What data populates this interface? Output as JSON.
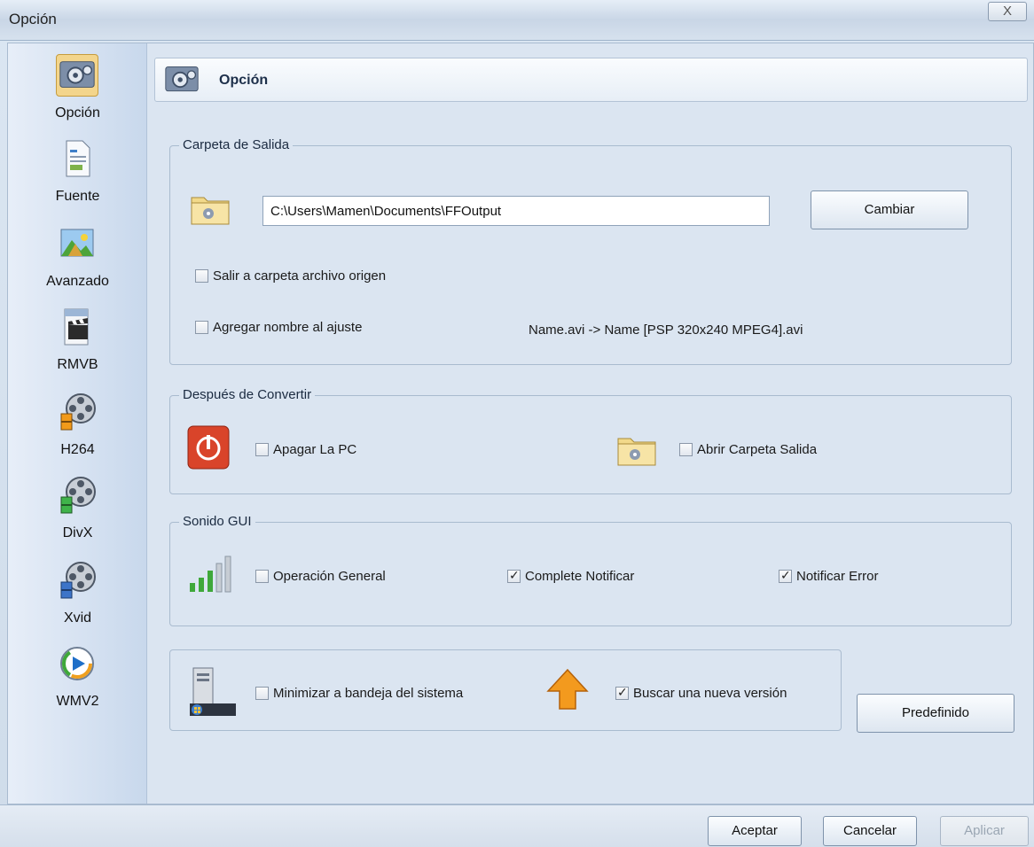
{
  "window": {
    "title": "Opción",
    "close_glyph": "X"
  },
  "sidebar": {
    "items": [
      {
        "label": "Opción",
        "icon": "settings-icon",
        "active": true
      },
      {
        "label": "Fuente",
        "icon": "document-icon"
      },
      {
        "label": "Avanzado",
        "icon": "landscape-image-icon"
      },
      {
        "label": "RMVB",
        "icon": "clapperboard-icon"
      },
      {
        "label": "H264",
        "icon": "film-reel-icon"
      },
      {
        "label": "DivX",
        "icon": "film-reel-icon"
      },
      {
        "label": "Xvid",
        "icon": "film-reel-icon"
      },
      {
        "label": "WMV2",
        "icon": "media-player-icon"
      }
    ]
  },
  "header": {
    "title": "Opción"
  },
  "output_folder": {
    "legend": "Carpeta de Salida",
    "path": "C:\\Users\\Mamen\\Documents\\FFOutput",
    "change_label": "Cambiar",
    "source_folder_label": "Salir a carpeta archivo origen",
    "source_folder_checked": false,
    "add_name_label": "Agregar nombre al ajuste",
    "add_name_checked": false,
    "name_example": "Name.avi  -> Name [PSP 320x240 MPEG4].avi"
  },
  "after_convert": {
    "legend": "Después de Convertir",
    "shutdown_label": "Apagar La PC",
    "shutdown_checked": false,
    "open_folder_label": "Abrir Carpeta Salida",
    "open_folder_checked": false
  },
  "sound": {
    "legend": "Sonido GUI",
    "general_label": "Operación General",
    "general_checked": false,
    "complete_label": "Complete Notificar",
    "complete_checked": true,
    "error_label": "Notificar Error",
    "error_checked": true
  },
  "misc": {
    "tray_label": "Minimizar a bandeja del sistema",
    "tray_checked": false,
    "update_label": "Buscar una nueva versión",
    "update_checked": true
  },
  "buttons": {
    "default_label": "Predefinido",
    "ok_label": "Aceptar",
    "cancel_label": "Cancelar",
    "apply_label": "Aplicar"
  },
  "colors": {
    "accent": "#f3d58c",
    "shutdown_red": "#d9442a",
    "update_orange": "#f39a1e",
    "signal_green": "#3fa83a"
  }
}
